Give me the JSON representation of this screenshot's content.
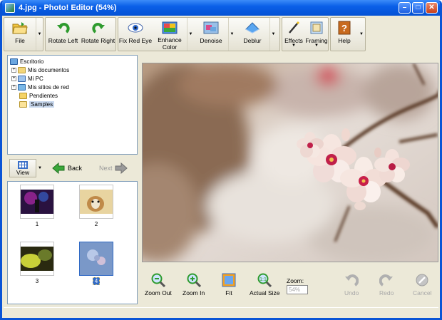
{
  "window": {
    "title": "4.jpg - Photo! Editor (54%)"
  },
  "toolbar": {
    "file": "File",
    "rotate_left": "Rotate Left",
    "rotate_right": "Rotate Right",
    "fix_red_eye": "Fix Red Eye",
    "enhance_color_1": "Enhance",
    "enhance_color_2": "Color",
    "denoise": "Denoise",
    "deblur": "Deblur",
    "effects": "Effects",
    "framing": "Framing",
    "help": "Help"
  },
  "tree": {
    "items": [
      {
        "label": "Escritorio"
      },
      {
        "label": "Mis documentos"
      },
      {
        "label": "Mi PC"
      },
      {
        "label": "Mis sitios de red"
      },
      {
        "label": "Pendientes"
      },
      {
        "label": "Samples"
      }
    ]
  },
  "nav": {
    "view": "View",
    "back": "Back",
    "next": "Next"
  },
  "thumbnails": [
    {
      "label": "1"
    },
    {
      "label": "2"
    },
    {
      "label": "3"
    },
    {
      "label": "4"
    }
  ],
  "bottom": {
    "zoom_out": "Zoom Out",
    "zoom_in": "Zoom In",
    "fit": "Fit",
    "actual_size": "Actual Size",
    "zoom_label": "Zoom:",
    "zoom_value": "54%",
    "undo": "Undo",
    "redo": "Redo",
    "cancel": "Cancel"
  },
  "colors": {
    "titlebar": "#0a5fe8",
    "window_bg": "#ece9d8",
    "selection": "#316ac5"
  }
}
